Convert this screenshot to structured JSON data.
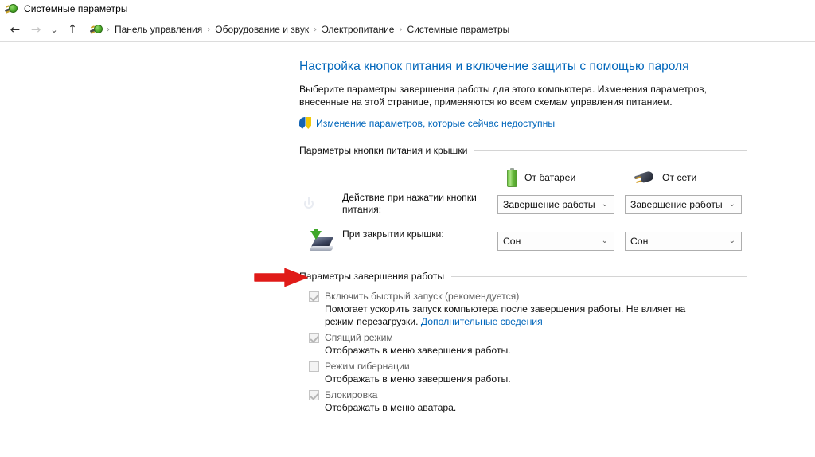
{
  "window": {
    "title": "Системные параметры",
    "app_icon": "power-plug-icon"
  },
  "nav": {
    "back_glyph": "←",
    "forward_glyph": "→",
    "recent_glyph": "⌄",
    "up_glyph": "↑",
    "separator": "›",
    "breadcrumbs": [
      {
        "label": "Панель управления"
      },
      {
        "label": "Оборудование и звук"
      },
      {
        "label": "Электропитание"
      },
      {
        "label": "Системные параметры"
      }
    ]
  },
  "page": {
    "title": "Настройка кнопок питания и включение защиты с помощью пароля",
    "description": "Выберите параметры завершения работы для этого компьютера. Изменения параметров, внесенные на этой странице, применяются ко всем схемам управления питанием.",
    "uac_link": "Изменение параметров, которые сейчас недоступны",
    "uac_icon": "shield-icon"
  },
  "power_button_group": {
    "header": "Параметры кнопки питания и крышки",
    "columns": [
      {
        "label": "От батареи",
        "icon": "battery-icon"
      },
      {
        "label": "От сети",
        "icon": "power-plug-icon"
      }
    ],
    "rows": [
      {
        "icon": "power-button-icon",
        "label": "Действие при нажатии кнопки питания:",
        "battery_value": "Завершение работы",
        "mains_value": "Завершение работы",
        "chevron": "⌄"
      },
      {
        "icon": "laptop-lid-icon",
        "label": "При закрытии крышки:",
        "battery_value": "Сон",
        "mains_value": "Сон",
        "chevron": "⌄"
      }
    ]
  },
  "shutdown_group": {
    "header": "Параметры завершения работы",
    "items": [
      {
        "label": "Включить быстрый запуск (рекомендуется)",
        "checked": true,
        "disabled": true,
        "description": "Помогает ускорить запуск компьютера после завершения работы. Не влияет на режим перезагрузки.",
        "link": "Дополнительные сведения"
      },
      {
        "label": "Спящий режим",
        "checked": true,
        "disabled": true,
        "description": "Отображать в меню завершения работы.",
        "link": ""
      },
      {
        "label": "Режим гибернации",
        "checked": false,
        "disabled": true,
        "description": "Отображать в меню завершения работы.",
        "link": ""
      },
      {
        "label": "Блокировка",
        "checked": true,
        "disabled": true,
        "description": "Отображать в меню аватара.",
        "link": ""
      }
    ]
  },
  "annotation": {
    "arrow_color": "#e01b18",
    "points_to": "Включить быстрый запуск (рекомендуется)"
  }
}
